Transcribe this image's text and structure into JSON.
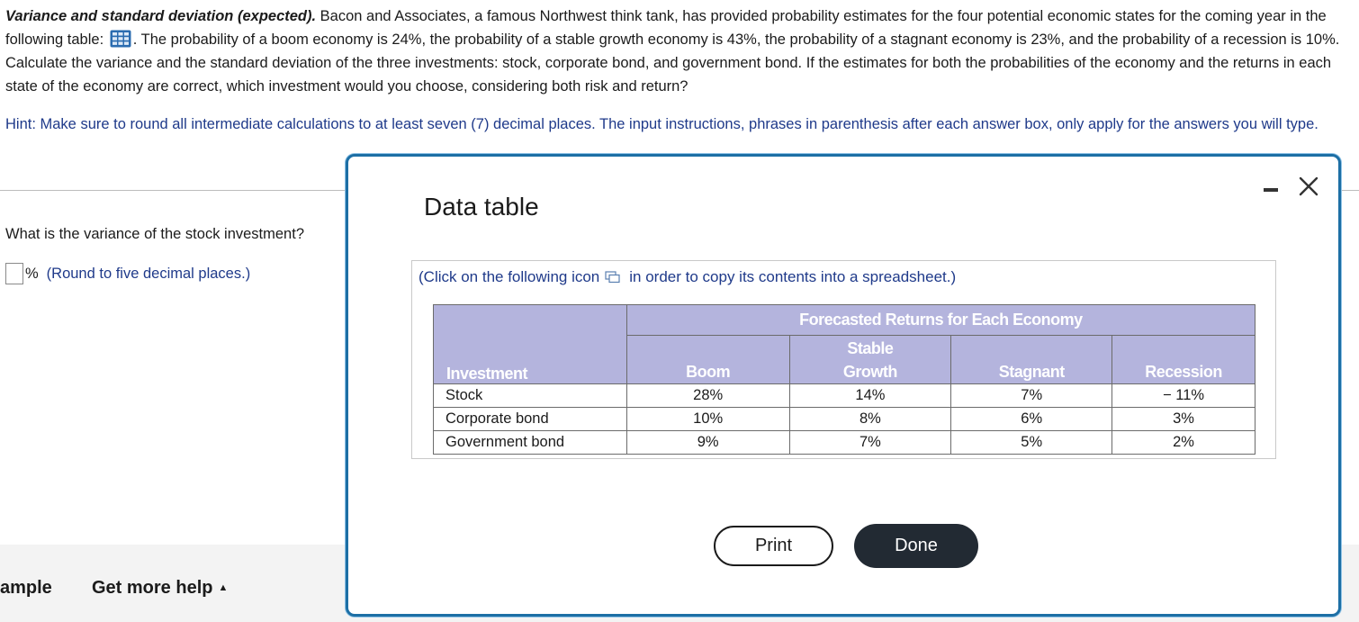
{
  "problem": {
    "title": "Variance and standard deviation (expected).",
    "text_before_icon": "Bacon and Associates, a famous Northwest think tank, has provided probability estimates for the four potential economic states for the coming year in the following table:",
    "text_after_icon": ". The probability of a boom economy is 24%, the probability of a stable growth economy is 43%, the probability of a stagnant economy is 23%, and the probability of a recession is 10%. Calculate the variance and the standard deviation of the three investments: stock, corporate bond, and government bond. If the estimates for both the probabilities of the economy and the returns in each state of the economy are correct, which investment would you choose, considering both risk and return?",
    "table_icon": "table-grid-icon"
  },
  "hint": "Hint: Make sure to round all intermediate calculations to at least seven (7) decimal places. The input instructions, phrases in parenthesis after each answer box, only apply for the answers you will type.",
  "question": {
    "text": "What is the variance of the stock investment?",
    "unit": "%",
    "round_note": "(Round to five decimal places.)",
    "answer_value": ""
  },
  "footer": {
    "example_label": "ample",
    "help_label": "Get more help",
    "help_caret": "▲"
  },
  "modal": {
    "title": "Data table",
    "copy_note_before": "(Click on the following icon",
    "copy_note_after": "in order to copy its contents into a spreadsheet.)",
    "table": {
      "group_header": "Forecasted Returns for Each Economy",
      "first_col_header": "Investment",
      "columns": [
        "Boom",
        "Stable Growth",
        "Stagnant",
        "Recession"
      ],
      "stable_line1": "Stable",
      "stable_line2": "Growth",
      "rows": [
        {
          "name": "Stock",
          "values": [
            "28%",
            "14%",
            "7%",
            "− 11%"
          ]
        },
        {
          "name": "Corporate bond",
          "values": [
            "10%",
            "8%",
            "6%",
            "3%"
          ]
        },
        {
          "name": "Government bond",
          "values": [
            "9%",
            "7%",
            "5%",
            "2%"
          ]
        }
      ]
    },
    "print_label": "Print",
    "done_label": "Done"
  },
  "colors": {
    "modal_border": "#1d6fa5",
    "table_header_bg": "#b4b4dd",
    "hint_text": "#1f3a8a",
    "done_bg": "#222a33"
  }
}
